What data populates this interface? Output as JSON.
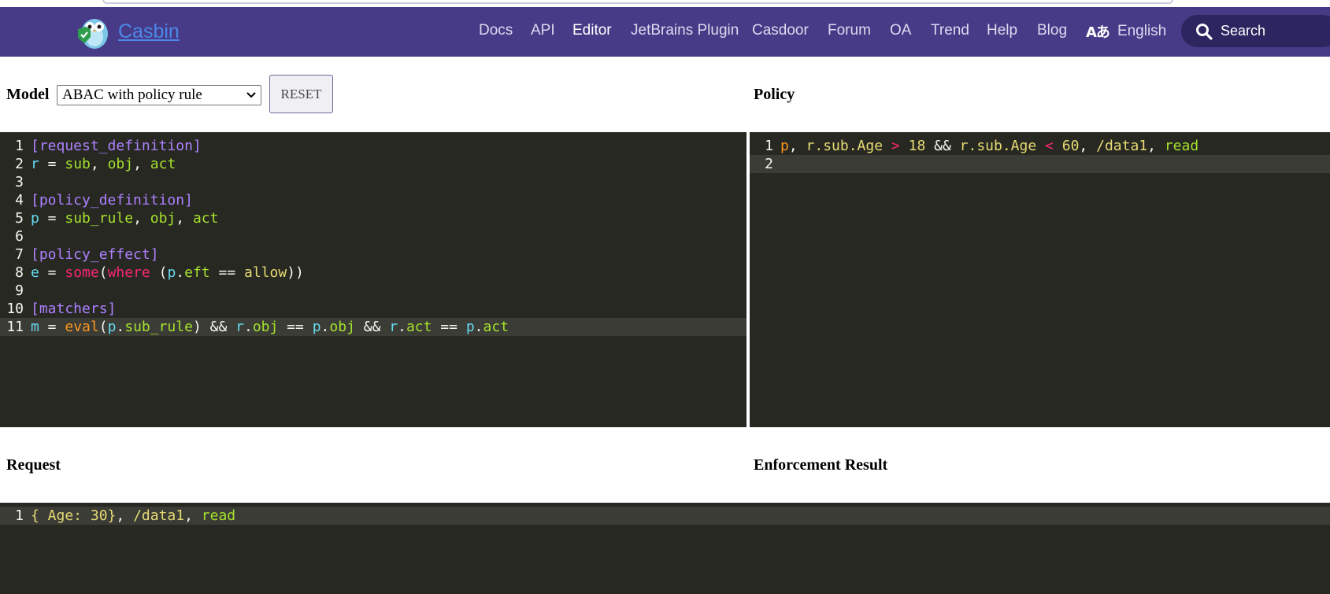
{
  "navbar": {
    "brand": "Casbin",
    "links": [
      "Docs",
      "API",
      "Editor",
      "JetBrains Plugin",
      "Casdoor",
      "Forum",
      "OA",
      "Trend",
      "Help",
      "Blog"
    ],
    "active_link": "Editor",
    "language_icon": "Aあ",
    "language": "English",
    "search_label": "Search"
  },
  "model": {
    "label": "Model",
    "select_value": "ABAC with policy rule",
    "reset_label": "RESET"
  },
  "policy": {
    "label": "Policy"
  },
  "request": {
    "label": "Request"
  },
  "result": {
    "label": "Enforcement Result"
  },
  "model_editor": {
    "line_numbers": [
      "1",
      "2",
      "3",
      "4",
      "5",
      "6",
      "7",
      "8",
      "9",
      "10",
      "11"
    ],
    "lines": [
      "[request_definition]",
      "r = sub, obj, act",
      "",
      "[policy_definition]",
      "p = sub_rule, obj, act",
      "",
      "[policy_effect]",
      "e = some(where (p.eft == allow))",
      "",
      "[matchers]",
      "m = eval(p.sub_rule) && r.obj == p.obj && r.act == p.act"
    ]
  },
  "policy_editor": {
    "line_numbers": [
      "1",
      "2"
    ],
    "lines": [
      "p, r.sub.Age > 18 && r.sub.Age < 60, /data1, read",
      ""
    ]
  },
  "request_editor": {
    "line_numbers": [
      "1"
    ],
    "lines": [
      "{ Age: 30}, /data1, read"
    ]
  },
  "colors": {
    "navbar": "#473b87",
    "editor_bg": "#272822",
    "section": "#ae81ff",
    "keyword": "#f92672",
    "identifier": "#a6e22e",
    "variable": "#66d9ef",
    "function": "#fd971f",
    "string": "#e6db74"
  }
}
